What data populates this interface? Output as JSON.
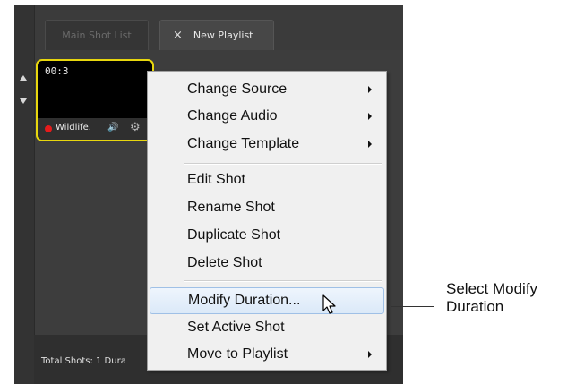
{
  "tabs": {
    "main_shot_list": "Main Shot List",
    "close_symbol": "×",
    "new_playlist": "New Playlist"
  },
  "shot": {
    "time": "00:3",
    "name": "Wildlife.",
    "speaker_glyph": "🔊",
    "gear_glyph": "⚙"
  },
  "footer": {
    "total_label": "Total Shots:  1 Dura"
  },
  "context_menu": {
    "items": [
      {
        "label": "Change Source",
        "submenu": true
      },
      {
        "label": "Change Audio",
        "submenu": true
      },
      {
        "label": "Change Template",
        "submenu": true
      },
      {
        "label": "Edit Shot",
        "submenu": false
      },
      {
        "label": "Rename Shot",
        "submenu": false
      },
      {
        "label": "Duplicate Shot",
        "submenu": false
      },
      {
        "label": "Delete Shot",
        "submenu": false
      },
      {
        "label": "Modify Duration...",
        "submenu": false,
        "highlighted": true
      },
      {
        "label": "Set Active Shot",
        "submenu": false
      },
      {
        "label": "Move to Playlist",
        "submenu": true
      }
    ]
  },
  "callout": {
    "line1": "Select Modify",
    "line2": "Duration"
  },
  "colors": {
    "selection_border": "#e8d70e",
    "record_dot": "#e51b1b",
    "menu_highlight": "#dbe9f8"
  }
}
